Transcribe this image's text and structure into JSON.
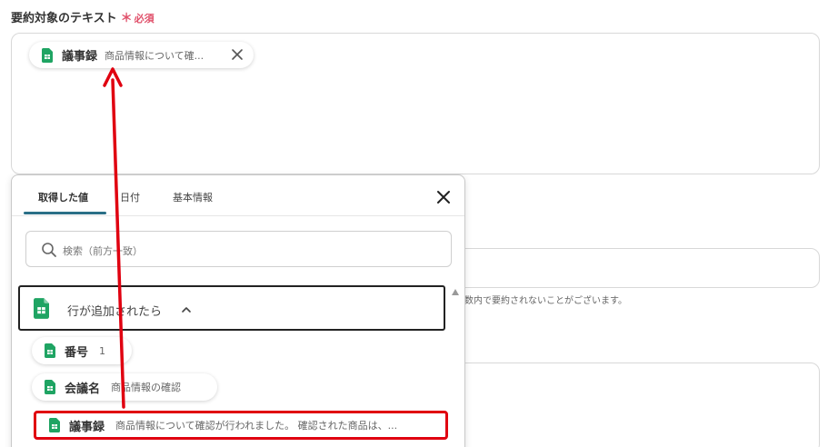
{
  "field": {
    "label": "要約対象のテキスト",
    "required_mark": "＊",
    "required_text": "必須",
    "selected_chip": {
      "name": "議事録",
      "value": "商品情報について確..."
    }
  },
  "background": {
    "note_fragment": "数内で要約されないことがございます。"
  },
  "panel": {
    "tabs": [
      {
        "label": "取得した値",
        "active": true
      },
      {
        "label": "日付",
        "active": false
      },
      {
        "label": "基本情報",
        "active": false
      }
    ],
    "search": {
      "placeholder": "検索（前方一致）"
    },
    "section": {
      "title": "行が追加されたら"
    },
    "items": [
      {
        "name": "番号",
        "value": "1"
      },
      {
        "name": "会議名",
        "value": "商品情報の確認"
      },
      {
        "name": "議事録",
        "value": "商品情報について確認が行われました。 確認された商品は、..."
      }
    ]
  },
  "colors": {
    "sheets_green": "#1fa463",
    "required_red": "#e0506a",
    "tab_accent": "#2a6f87",
    "highlight_red": "#e00010"
  },
  "icons": {
    "sheet": "google-sheets-icon",
    "close": "close-icon",
    "search": "search-icon",
    "chevron": "chevron-up-icon"
  }
}
